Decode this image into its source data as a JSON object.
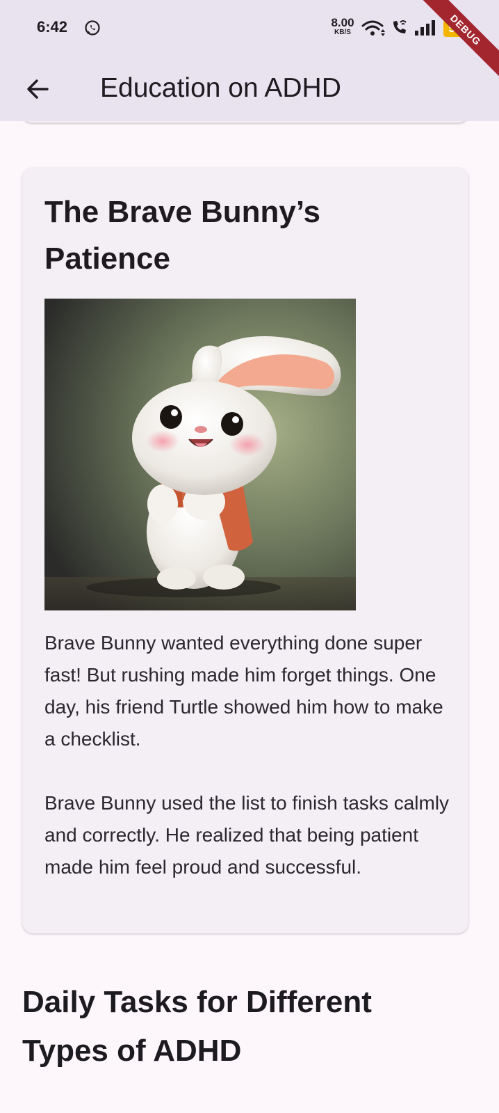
{
  "status_bar": {
    "time": "6:42",
    "net_speed_value": "8.00",
    "net_speed_unit": "KB/S",
    "battery": "50",
    "debug_banner": "DEBUG"
  },
  "app_bar": {
    "title": "Education on ADHD",
    "back_icon": "arrow-left-icon"
  },
  "story_card": {
    "title": "The Brave Bunny’s Patience",
    "image": "bunny-illustration",
    "paragraphs": [
      "Brave Bunny wanted everything done super fast! But rushing made him forget things. One day, his friend Turtle showed him how to make a checklist.",
      "Brave Bunny used the list to finish tasks calmly and correctly. He realized that being patient made him feel proud and successful."
    ]
  },
  "next_section": {
    "heading": "Daily Tasks for Different Types of ADHD"
  },
  "colors": {
    "app_bar_bg": "#e9e2ef",
    "page_bg": "#fdf7fc",
    "card_bg": "#f4eff5",
    "text": "#1d1b20",
    "battery": "#f2b600",
    "debug": "#a3262f"
  }
}
